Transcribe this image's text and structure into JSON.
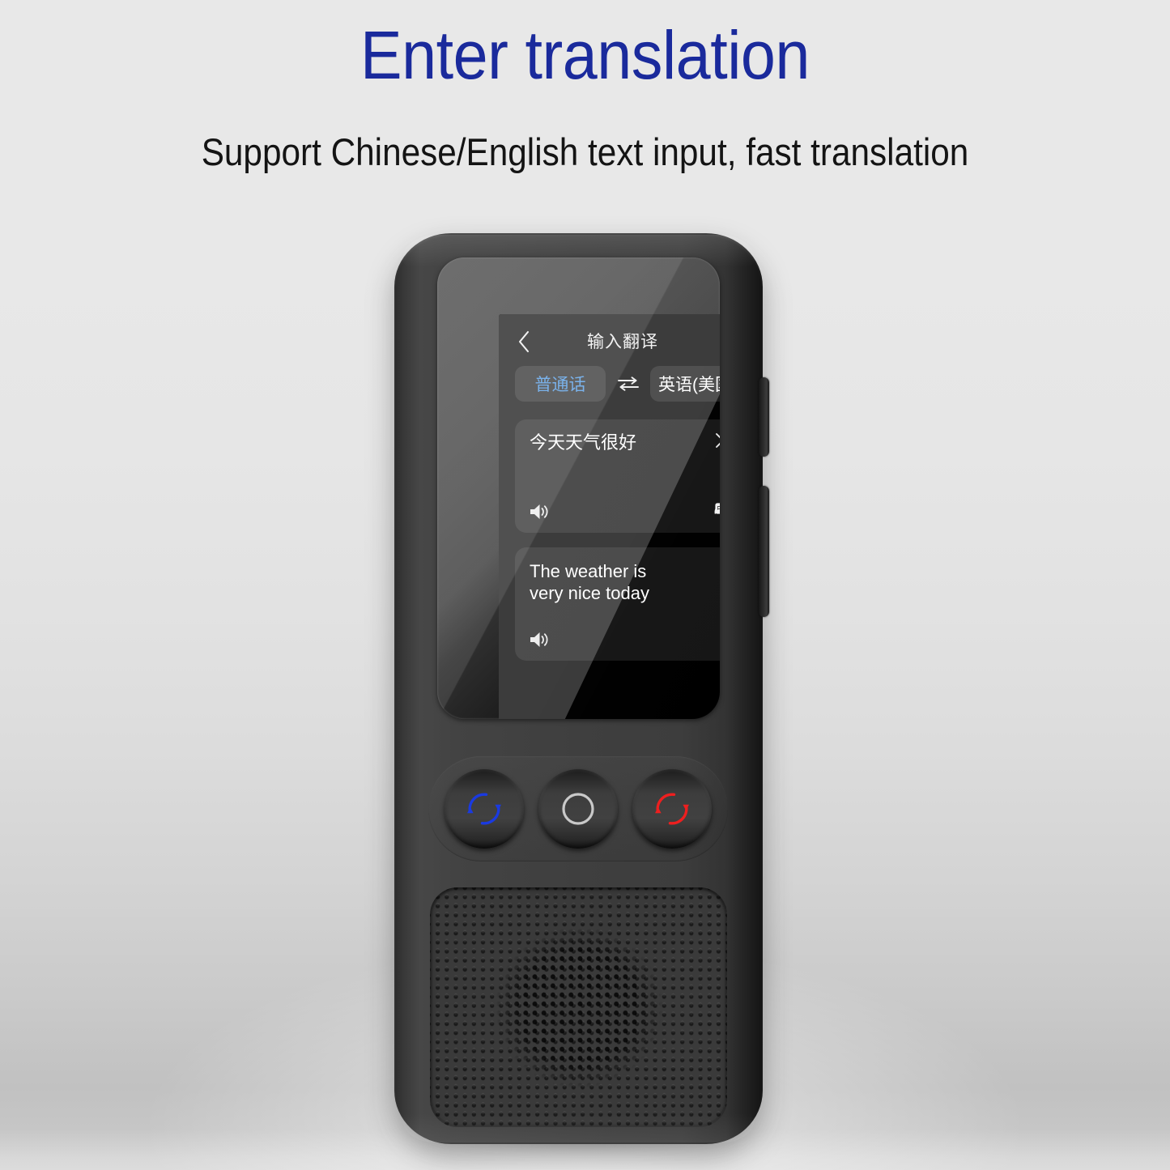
{
  "page": {
    "title": "Enter translation",
    "subtitle": "Support Chinese/English text input, fast translation",
    "title_color": "#1a2a9c"
  },
  "device": {
    "side_buttons": [
      "volume-up-button",
      "volume-down-button"
    ],
    "screen": {
      "header": {
        "back_icon": "back-chevron-icon",
        "title": "输入翻译"
      },
      "language_bar": {
        "source_language": "普通话",
        "target_language": "英语(美国)",
        "swap_icon": "swap-arrows-icon",
        "source_color": "#69a8e8",
        "target_color": "#ffffff"
      },
      "input_card": {
        "text": "今天天气很好",
        "close_icon": "close-x-icon",
        "speaker_icon": "speaker-icon",
        "translate_icon": "translate-icon",
        "translate_icon_glyphs": [
          "中",
          "A"
        ]
      },
      "output_card": {
        "text": "The weather is\nvery nice today",
        "speaker_icon": "speaker-icon"
      }
    },
    "buttons": [
      {
        "name": "blue-translate-button",
        "icon": "circular-arrows-icon",
        "color": "#1a3ae0"
      },
      {
        "name": "home-button",
        "icon": "ring-icon",
        "color": "#c9c9c9"
      },
      {
        "name": "red-translate-button",
        "icon": "circular-arrows-icon",
        "color": "#ee1f1f"
      }
    ],
    "speaker": {
      "name": "speaker-grille"
    }
  }
}
